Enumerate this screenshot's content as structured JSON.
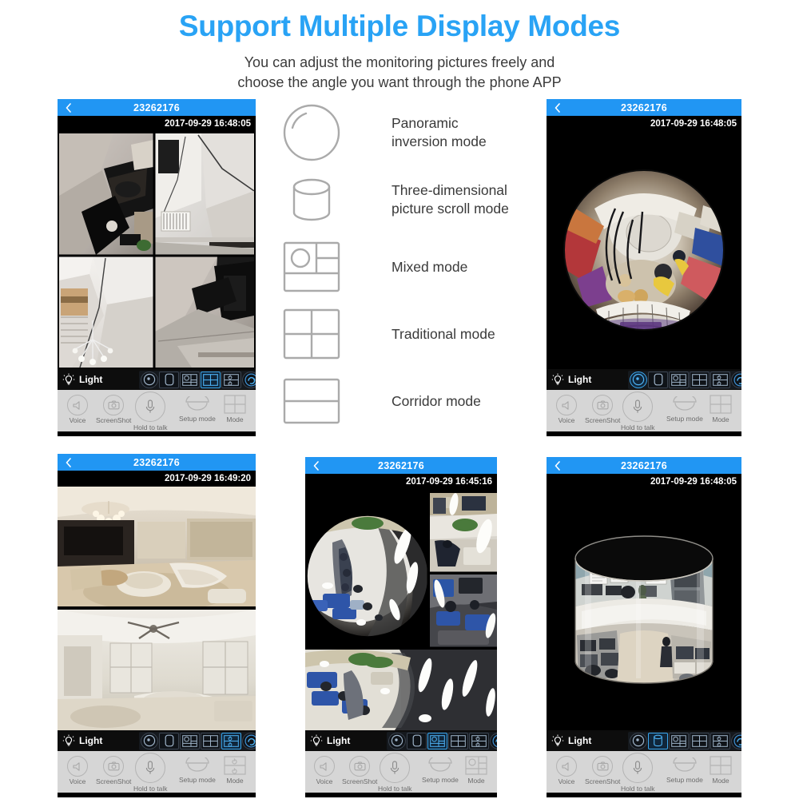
{
  "header": {
    "title": "Support Multiple Display Modes",
    "subtitle_line1": "You can adjust the monitoring pictures freely and",
    "subtitle_line2": "choose the angle you want through the phone APP",
    "title_color": "#29a3f5"
  },
  "legend": {
    "items": [
      {
        "icon": "sphere-icon",
        "label_line1": "Panoramic",
        "label_line2": "inversion mode"
      },
      {
        "icon": "cylinder-icon",
        "label_line1": "Three-dimensional",
        "label_line2": "picture scroll mode"
      },
      {
        "icon": "mixed-layout-icon",
        "label_line1": "Mixed mode",
        "label_line2": ""
      },
      {
        "icon": "grid-four-icon",
        "label_line1": "Traditional mode",
        "label_line2": ""
      },
      {
        "icon": "corridor-icon",
        "label_line1": "Corridor mode",
        "label_line2": ""
      }
    ]
  },
  "toolbar": {
    "light_label": "Light",
    "light_icon": "bulb-icon",
    "mode_icons": [
      "panoramic-icon",
      "cylinder-icon",
      "mixed-icon",
      "traditional-icon",
      "corridor-icon",
      "rotate-icon"
    ],
    "bottom_items": [
      {
        "icon": "speaker-icon",
        "label": "Voice"
      },
      {
        "icon": "camera-icon",
        "label": "ScreenShot"
      },
      {
        "icon": "microphone-icon",
        "label": "Hold to talk"
      },
      {
        "icon": "dome-icon",
        "label": "Setup mode"
      },
      {
        "icon": "mode-icon",
        "label": "Mode"
      }
    ]
  },
  "phones": [
    {
      "name": "phone-top-left",
      "device_id": "23262176",
      "timestamp": "2017-09-29 16:48:05",
      "active_mode_index": 3,
      "mode_button_icon": "traditional-icon",
      "view": "traditional-quad"
    },
    {
      "name": "phone-top-right",
      "device_id": "23262176",
      "timestamp": "2017-09-29 16:48:05",
      "active_mode_index": 0,
      "mode_button_icon": "traditional-icon",
      "view": "fisheye-circle-shop"
    },
    {
      "name": "phone-bottom-left",
      "device_id": "23262176",
      "timestamp": "2017-09-29 16:49:20",
      "active_mode_index": 4,
      "mode_button_icon": "corridor-icon",
      "view": "corridor-two-strips"
    },
    {
      "name": "phone-bottom-center",
      "device_id": "23262176",
      "timestamp": "2017-09-29 16:45:16",
      "active_mode_index": 2,
      "mode_button_icon": "mixed-icon",
      "view": "mixed-layout"
    },
    {
      "name": "phone-bottom-right",
      "device_id": "23262176",
      "timestamp": "2017-09-29 16:48:05",
      "active_mode_index": 1,
      "mode_button_icon": "traditional-icon",
      "view": "cylinder-3d"
    }
  ],
  "colors": {
    "accent_blue": "#2196f3",
    "title_blue": "#29a3f5",
    "toolbar_dark": "#0d0d0d",
    "bottom_bar_gray": "#d6d6d6",
    "legend_gray": "#aaaaaa"
  }
}
